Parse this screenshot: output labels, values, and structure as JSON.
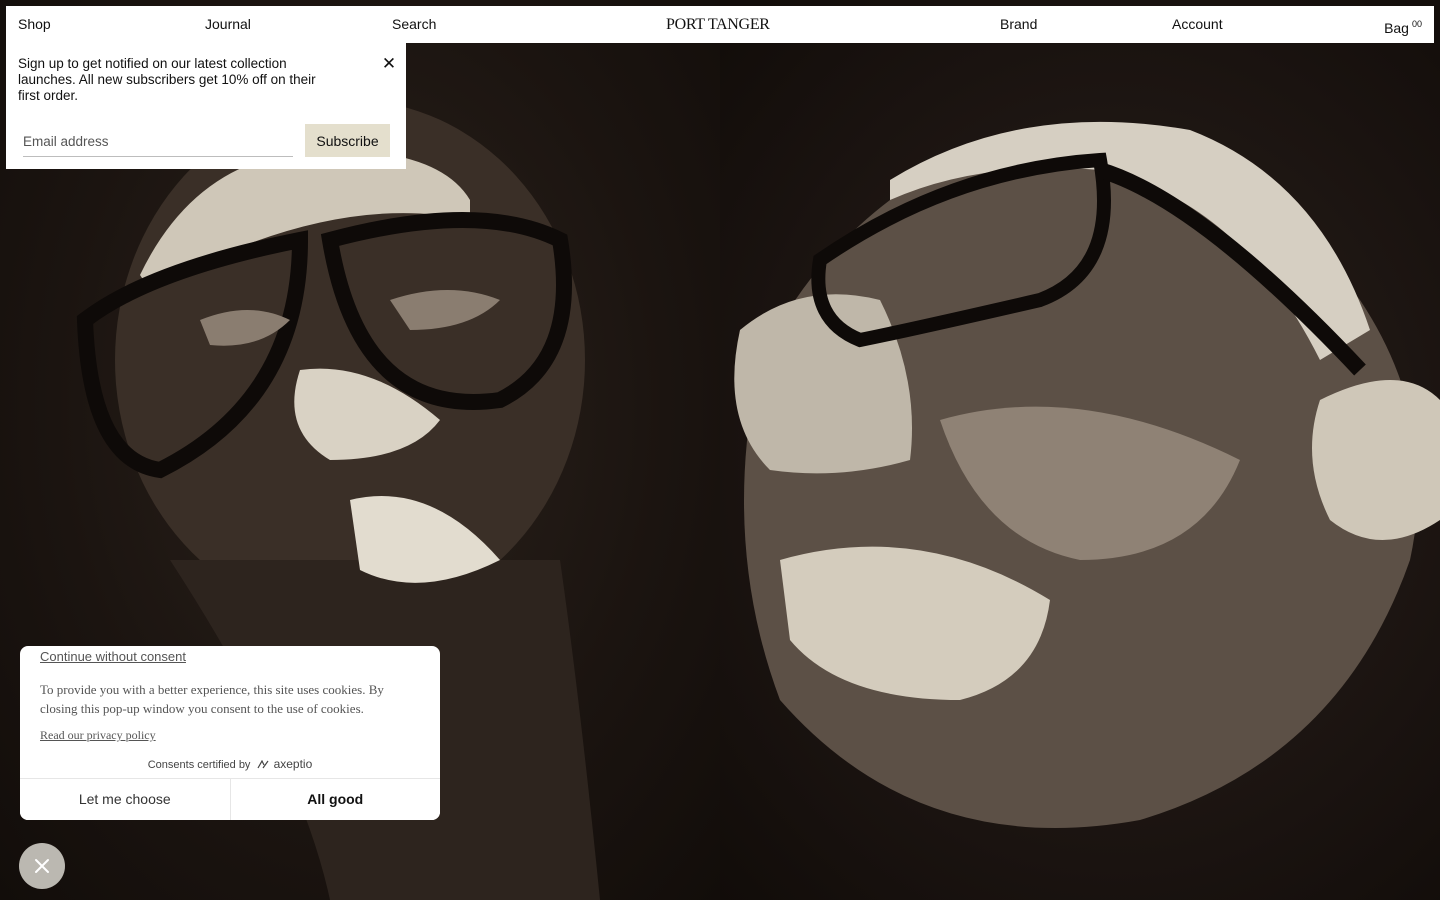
{
  "nav": {
    "shop": "Shop",
    "journal": "Journal",
    "search": "Search",
    "logo": "PORT TANGER",
    "brand": "Brand",
    "account": "Account",
    "bag": "Bag",
    "bag_count": "00"
  },
  "newsletter": {
    "text": "Sign up to get notified on our latest collection launches. All new subscribers get 10% off on their first order.",
    "close_icon": "close-icon",
    "email_placeholder": "Email address",
    "email_value": "",
    "subscribe_label": "Subscribe"
  },
  "cookie": {
    "continue_label": "Continue without consent",
    "text": "To provide you with a better experience, this site uses cookies. By closing this pop-up window you consent to the use of cookies.",
    "privacy_label": "Read our privacy policy",
    "certified_label": "Consents certified by",
    "certified_brand": "axeptio",
    "choose_label": "Let me choose",
    "accept_label": "All good"
  },
  "floating_button": {
    "icon": "close-icon"
  },
  "hero": {
    "left_image": "portrait-man-round-glasses",
    "right_image": "portrait-man-rectangular-glasses"
  },
  "colors": {
    "background": "#1d1612",
    "subscribe_bg": "#e4dfcd",
    "float_button_bg": "#bbb8b1"
  }
}
